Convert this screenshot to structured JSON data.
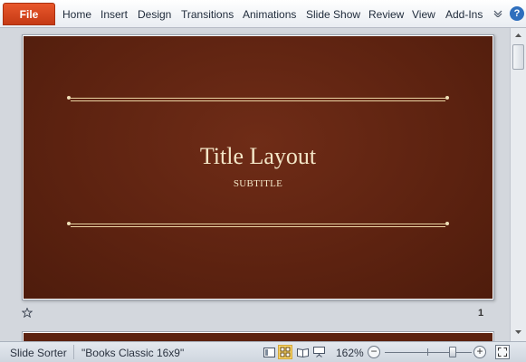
{
  "ribbon": {
    "file_label": "File",
    "tabs": [
      "Home",
      "Insert",
      "Design",
      "Transitions",
      "Animations",
      "Slide Show",
      "Review",
      "View",
      "Add-Ins"
    ],
    "minimize_icon": "chevron-down-icon",
    "help_icon": "help-icon",
    "help_glyph": "?",
    "accent_color": "#d24a1e"
  },
  "slide": {
    "title": "Title Layout",
    "subtitle": "SUBTITLE",
    "number": "1",
    "background_color": "#5c2210",
    "text_color": "#f3e6c7"
  },
  "statusbar": {
    "view_label": "Slide Sorter",
    "theme_label": "\"Books Classic 16x9\"",
    "zoom": "162%",
    "zoom_out_glyph": "−",
    "zoom_in_glyph": "+"
  }
}
